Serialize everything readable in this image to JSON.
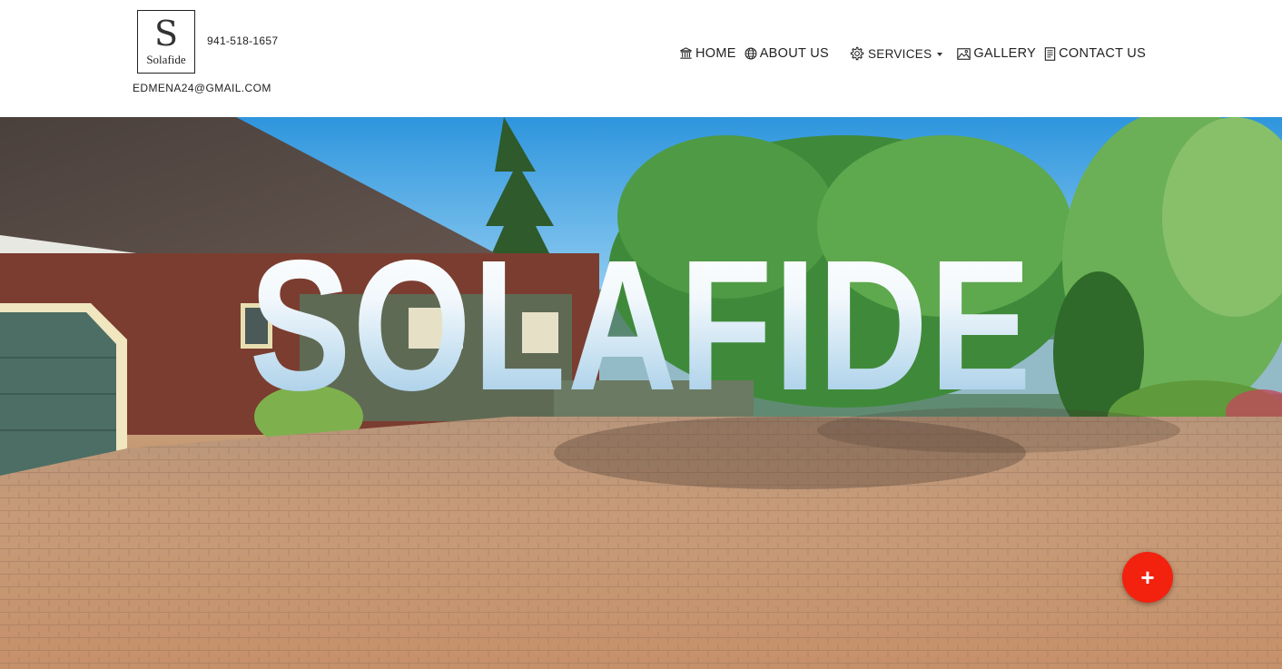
{
  "brand": {
    "logo_letter": "S",
    "logo_word": "Solafide",
    "phone": "941-518-1657",
    "email": "EDMENA24@GMAIL.COM"
  },
  "nav": {
    "items": [
      {
        "label": "HOME",
        "icon": "bank-icon"
      },
      {
        "label": "ABOUT US",
        "icon": "globe-icon"
      },
      {
        "label": "SERVICES",
        "icon": "gear-icon",
        "dropdown": true
      },
      {
        "label": "GALLERY",
        "icon": "image-icon"
      },
      {
        "label": "CONTACT US",
        "icon": "document-icon"
      }
    ]
  },
  "hero": {
    "title": "SOLAFIDE"
  },
  "fab": {
    "label": "+"
  },
  "colors": {
    "fab": "#f2220e",
    "header_bg": "#ffffff",
    "text": "#222222"
  }
}
